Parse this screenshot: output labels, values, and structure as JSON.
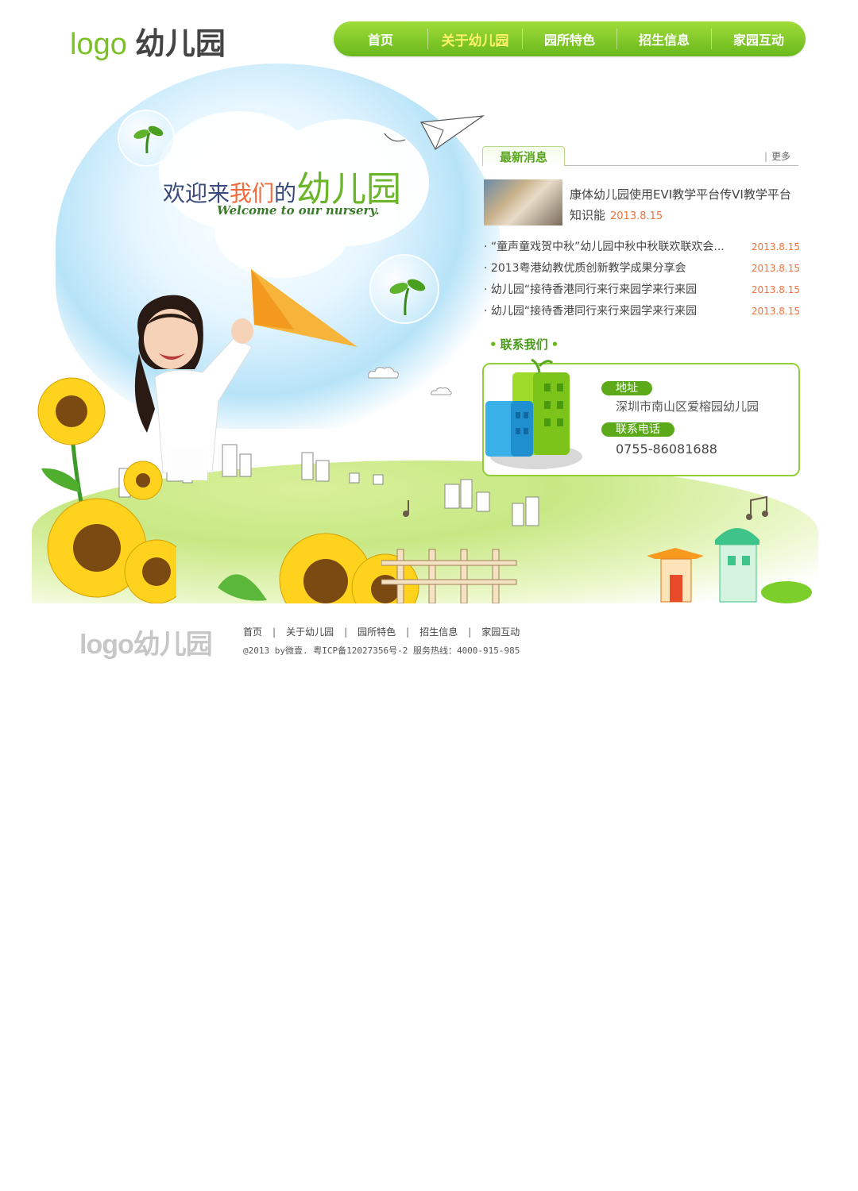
{
  "header": {
    "logo_prefix": "logo",
    "logo_name": "幼儿园",
    "nav": [
      "首页",
      "关于幼儿园",
      "园所特色",
      "招生信息",
      "家园互动"
    ],
    "active_index": 1
  },
  "hero": {
    "welcome_part1": "欢迎来",
    "welcome_part2": "我们",
    "welcome_part3": "的",
    "welcome_part4": "幼儿园",
    "welcome_en": "Welcome to our nursery."
  },
  "news": {
    "tab_label": "最新消息",
    "more_label": "更多",
    "feature": {
      "title": "康体幼儿园使用EVI教学平台传VI教学平台知识能",
      "date": "2013.8.15"
    },
    "items": [
      {
        "title": "“童声童戏贺中秋”幼儿园中秋中秋联欢联欢会...",
        "date": "2013.8.15"
      },
      {
        "title": "2013粤港幼教优质创新教学成果分享会",
        "date": "2013.8.15"
      },
      {
        "title": "幼儿园“接待香港同行来行来园学来行来园",
        "date": "2013.8.15"
      },
      {
        "title": "幼儿园“接待香港同行来行来园学来行来园",
        "date": "2013.8.15"
      }
    ]
  },
  "contact": {
    "title": "联系我们",
    "address_label": "地址",
    "address": "深圳市南山区爱榕园幼儿园",
    "phone_label": "联系电话",
    "phone": "0755-86081688"
  },
  "footer": {
    "logo": "logo幼儿园",
    "nav": [
      "首页",
      "关于幼儿园",
      "园所特色",
      "招生信息",
      "家园互动"
    ],
    "separator": "|",
    "copyright": "@2013 by微壹. 粤ICP备12027356号-2 服务热线：4000-915-985"
  },
  "colors": {
    "brand_green": "#6ab81c",
    "accent_orange": "#f0723a",
    "nav_active": "#fff36a"
  }
}
